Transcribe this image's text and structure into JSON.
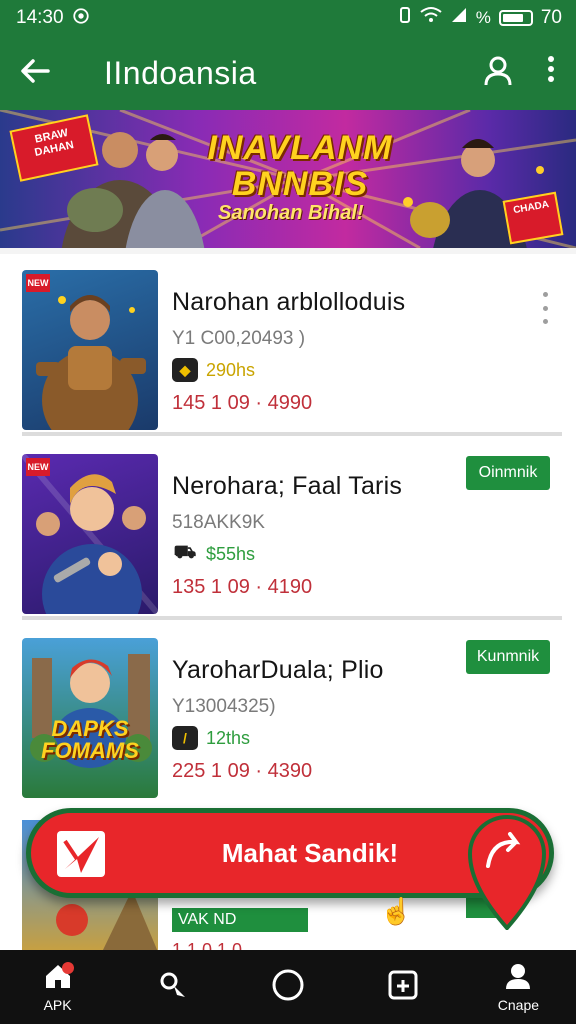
{
  "status_bar": {
    "time": "14:30",
    "left_icon": "whatsapp-icon",
    "right_icons": [
      "vibrate-icon",
      "wifi-icon",
      "signal-icon",
      "percent-icon",
      "battery-icon"
    ],
    "battery_text": "70"
  },
  "app_bar": {
    "title": "IIndoansia",
    "back_icon": "arrow-left-icon",
    "profile_icon": "user-icon",
    "menu_icon": "more-vert-icon"
  },
  "banner": {
    "title": "INAVLANM BNNBIS",
    "subtitle": "Sanohan Bihal!",
    "ribbon_left": "BRAW DAHAN",
    "ribbon_right": "CHADA"
  },
  "games": [
    {
      "title": "Narohan arblolloduis",
      "meta": "Y1 C00,20493 )",
      "rating": "290hs",
      "rating_color": "#c9a400",
      "price": "145 1 09 · 4990",
      "action": "menu",
      "badge": "NEW"
    },
    {
      "title": "Nerohara; Faal Taris",
      "meta": "518AKK9K",
      "rating": "$55hs",
      "rating_color": "#2e9d3e",
      "price": "135 1 09 · 4190",
      "action_label": "Oinmnik",
      "badge": "NEW"
    },
    {
      "title": "YarohаrDuala; Plio",
      "meta": "Y13004325)",
      "rating": "12ths",
      "rating_color": "#2e9d3e",
      "price": "225 1 09 · 4390",
      "action_label": "Kunmnik",
      "thumb_text": "DAPKS FOMAMS"
    }
  ],
  "partial_card": {
    "tag": "VAK ND",
    "price": "1 1 0 1 0"
  },
  "fab": {
    "label": "Mahat Sandik!",
    "left_icon": "send-icon",
    "right_icon": "share-arrow-icon"
  },
  "nav": {
    "items": [
      {
        "name": "home",
        "icon": "home-icon",
        "label": "APK"
      },
      {
        "name": "map",
        "icon": "pin-icon",
        "label": ""
      },
      {
        "name": "circle",
        "icon": "circle-icon",
        "label": ""
      },
      {
        "name": "apps",
        "icon": "app-box-icon",
        "label": ""
      },
      {
        "name": "profile",
        "icon": "person-icon",
        "label": "Cnape"
      }
    ]
  },
  "colors": {
    "primary": "#1f7a3a",
    "accent_red": "#e8262a",
    "price_red": "#c0303a",
    "button_green": "#1f8f3e"
  }
}
